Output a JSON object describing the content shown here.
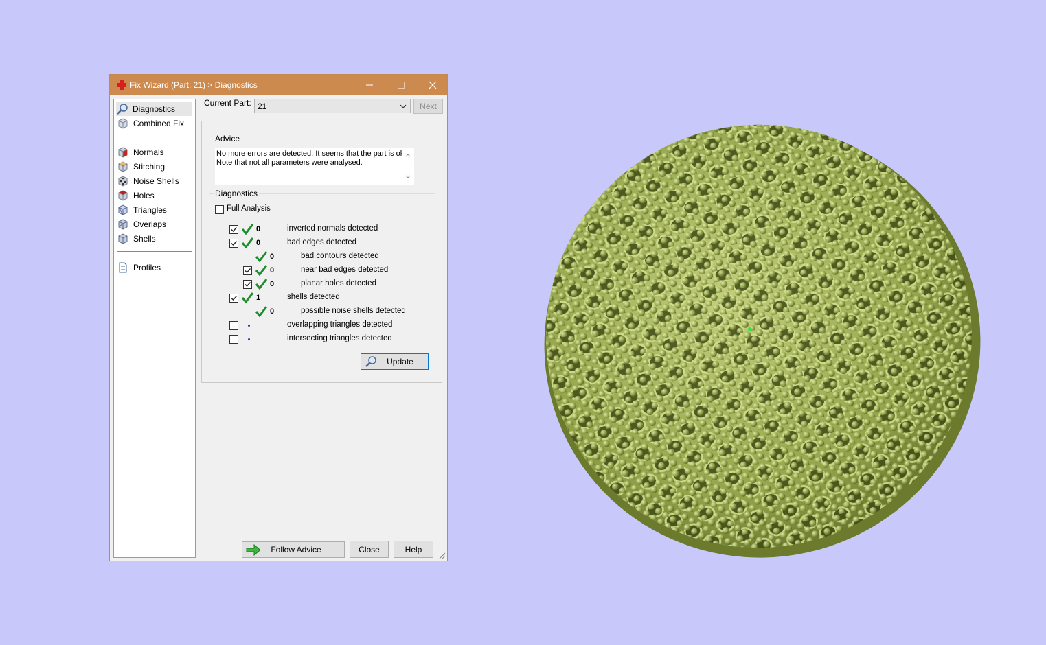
{
  "window": {
    "title": "Fix Wizard (Part: 21) > Diagnostics",
    "controls": {
      "minimize": "minimize",
      "maximize": "maximize",
      "close": "close"
    }
  },
  "sidebar": {
    "items": [
      {
        "label": "Diagnostics",
        "icon": "magnifier-icon",
        "selected": true
      },
      {
        "label": "Combined Fix",
        "icon": "cube-icon"
      },
      {
        "label": "Normals",
        "icon": "cube-red-face-icon"
      },
      {
        "label": "Stitching",
        "icon": "cube-stitch-icon"
      },
      {
        "label": "Noise Shells",
        "icon": "cube-dots-icon"
      },
      {
        "label": "Holes",
        "icon": "cube-hole-icon"
      },
      {
        "label": "Triangles",
        "icon": "cube-triangle-icon"
      },
      {
        "label": "Overlaps",
        "icon": "cube-overlap-icon"
      },
      {
        "label": "Shells",
        "icon": "cube-shell-icon"
      },
      {
        "label": "Profiles",
        "icon": "document-icon"
      }
    ]
  },
  "current_part": {
    "label": "Current Part:",
    "value": "21"
  },
  "next_button": "Next",
  "advice": {
    "title": "Advice",
    "text": "No more errors are detected. It seems that the part is ok.\nNote that not all parameters were analysed."
  },
  "diagnostics": {
    "title": "Diagnostics",
    "full_analysis_label": "Full Analysis",
    "full_analysis_checked": false,
    "rows": [
      {
        "checked": true,
        "status": "ok",
        "count": "0",
        "label": "inverted normals detected",
        "indent": 0
      },
      {
        "checked": true,
        "status": "ok",
        "count": "0",
        "label": "bad edges detected",
        "indent": 0
      },
      {
        "checked": null,
        "status": "ok",
        "count": "0",
        "label": "bad contours detected",
        "indent": 1
      },
      {
        "checked": true,
        "status": "ok",
        "count": "0",
        "label": "near bad edges detected",
        "indent": 1
      },
      {
        "checked": true,
        "status": "ok",
        "count": "0",
        "label": "planar holes detected",
        "indent": 1
      },
      {
        "checked": true,
        "status": "ok",
        "count": "1",
        "label": "shells detected",
        "indent": 0
      },
      {
        "checked": null,
        "status": "ok",
        "count": "0",
        "label": "possible noise shells detected",
        "indent": 1
      },
      {
        "checked": false,
        "status": "none",
        "count": "",
        "label": "overlapping triangles detected",
        "indent": 0
      },
      {
        "checked": false,
        "status": "none",
        "count": "",
        "label": "intersecting triangles detected",
        "indent": 0
      }
    ],
    "update_button": "Update"
  },
  "footer": {
    "follow_advice": "Follow Advice",
    "close": "Close",
    "help": "Help"
  },
  "colors": {
    "background": "#c8c8fa",
    "titlebar": "#cd8a4f",
    "check_green": "#1e8c2c",
    "model_green": "#9aa856"
  }
}
